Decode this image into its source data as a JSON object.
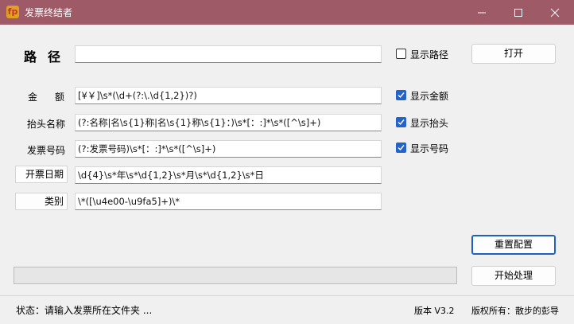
{
  "window": {
    "title": "发票终结者",
    "app_icon_glyph": "fp",
    "accent_color": "#9e5a67"
  },
  "path": {
    "label": "路径",
    "value": "",
    "show_checkbox": {
      "label": "显示路径",
      "checked": false
    },
    "open_button": "打开"
  },
  "fields": {
    "amount": {
      "label": "金额",
      "value": "[¥￥]\\s*(\\d+(?:\\.\\d{1,2})?)",
      "checkbox": {
        "label": "显示金额",
        "checked": true
      }
    },
    "header": {
      "label": "抬头名称",
      "value": "(?:名称|名\\s{1}称|名\\s{1}称\\s{1}：)\\s*[：:]*\\s*([^\\s]+)",
      "checkbox": {
        "label": "显示抬头",
        "checked": true
      }
    },
    "code": {
      "label": "发票号码",
      "value": "(?:发票号码)\\s*[：:]*\\s*([^\\s]+)",
      "checkbox": {
        "label": "显示号码",
        "checked": true
      }
    },
    "date": {
      "label": "开票日期",
      "value": "\\d{4}\\s*年\\s*\\d{1,2}\\s*月\\s*\\d{1,2}\\s*日"
    },
    "category": {
      "label": "类别",
      "value": "\\*([\\u4e00-\\u9fa5]+)\\*"
    }
  },
  "buttons": {
    "reset": "重置配置",
    "start": "开始处理"
  },
  "progress": {
    "value": 0
  },
  "status": {
    "text": "状态：请输入发票所在文件夹 ...",
    "version": "版本 V3.2",
    "copyright": "版权所有：散步的彭导"
  }
}
